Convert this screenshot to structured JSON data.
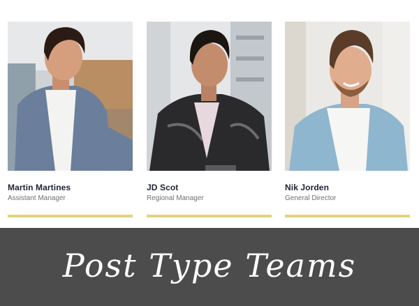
{
  "team": {
    "members": [
      {
        "name": "Martin Martines",
        "role": "Assistant Manager"
      },
      {
        "name": "JD Scot",
        "role": "Regional Manager"
      },
      {
        "name": "Nik Jorden",
        "role": "General Director"
      }
    ],
    "accent_color": "#e4d27a"
  },
  "banner": {
    "title": "Post Type Teams",
    "background_color": "#4c4c4c"
  }
}
